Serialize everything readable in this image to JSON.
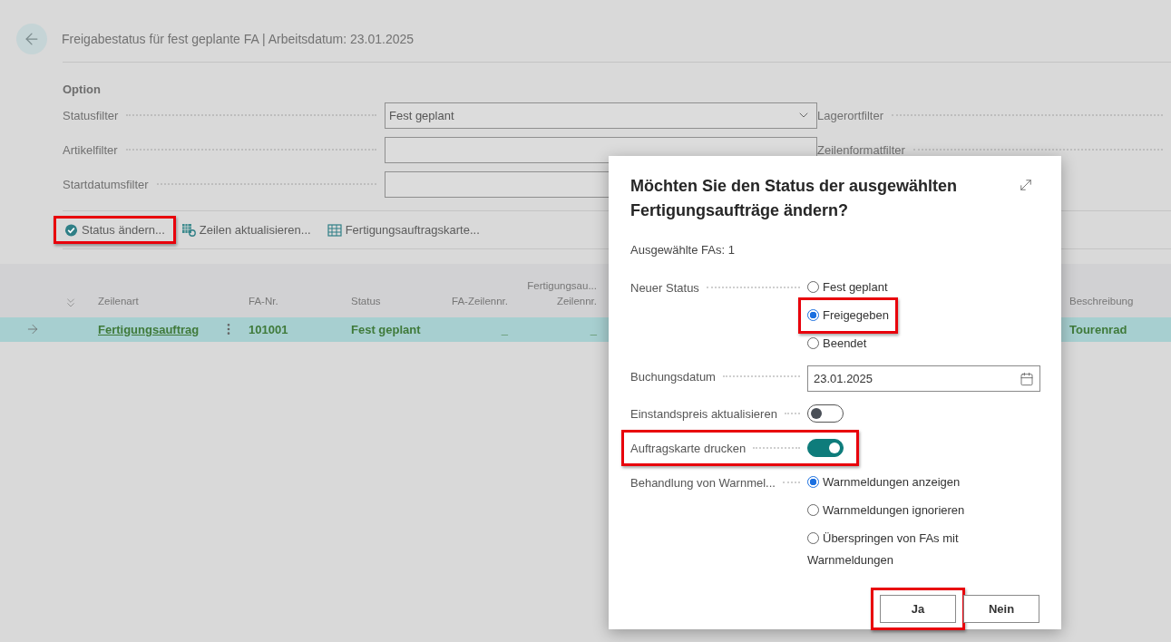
{
  "page": {
    "title": "Freigabestatus für fest geplante FA | Arbeitsdatum: 23.01.2025",
    "section": "Option",
    "filters_left": [
      {
        "kind": "dropdown",
        "label": "Statusfilter",
        "value": "Fest geplant"
      },
      {
        "kind": "text",
        "label": "Artikelfilter"
      },
      {
        "kind": "text",
        "label": "Startdatumsfilter"
      }
    ],
    "filters_right": [
      {
        "label": "Lagerortfilter"
      },
      {
        "label": "Zeilenformatfilter"
      }
    ],
    "actions": [
      {
        "kind": "status",
        "label": "Status ändern...",
        "highlighted": true
      },
      {
        "kind": "refresh",
        "label": "Zeilen aktualisieren...",
        "highlighted": false
      },
      {
        "kind": "card",
        "label": "Fertigungsauftragskarte...",
        "highlighted": false
      }
    ]
  },
  "table": {
    "columns": [
      "Zeilenart",
      "FA-Nr.",
      "Status",
      "FA-Zeilennr.",
      "Fertigungsau... Zeilennr.",
      "Beschreibung"
    ],
    "rows": [
      {
        "selected": true,
        "cells": [
          "Fertigungsauftrag",
          "101001",
          "Fest geplant",
          "_",
          "_",
          "Tourenrad"
        ]
      }
    ]
  },
  "dialog": {
    "title": "Möchten Sie den Status der ausgewählten Fertigungsaufträge ändern?",
    "subtitle": "Ausgewählte FAs: 1",
    "fields": [
      {
        "kind": "radio",
        "label": "Neuer Status",
        "options": [
          {
            "label": "Fest geplant",
            "selected": false,
            "highlighted": false
          },
          {
            "label": "Freigegeben",
            "selected": true,
            "highlighted": true
          },
          {
            "label": "Beendet",
            "selected": false,
            "highlighted": false
          }
        ]
      },
      {
        "kind": "date",
        "label": "Buchungsdatum",
        "value": "23.01.2025"
      },
      {
        "kind": "toggle",
        "label": "Einstandspreis aktualisieren",
        "on": false,
        "highlighted": false
      },
      {
        "kind": "toggle",
        "label": "Auftragskarte drucken",
        "on": true,
        "highlighted": true
      },
      {
        "kind": "radio",
        "label": "Behandlung von Warnmel...",
        "options": [
          {
            "label": "Warnmeldungen anzeigen",
            "selected": true,
            "highlighted": false
          },
          {
            "label": "Warnmeldungen ignorieren",
            "selected": false,
            "highlighted": false
          },
          {
            "label": "Überspringen von FAs mit Warnmeldungen",
            "selected": false,
            "highlighted": false
          }
        ]
      }
    ],
    "buttons": [
      {
        "label": "Ja",
        "highlighted": true
      },
      {
        "label": "Nein",
        "highlighted": false
      }
    ]
  }
}
